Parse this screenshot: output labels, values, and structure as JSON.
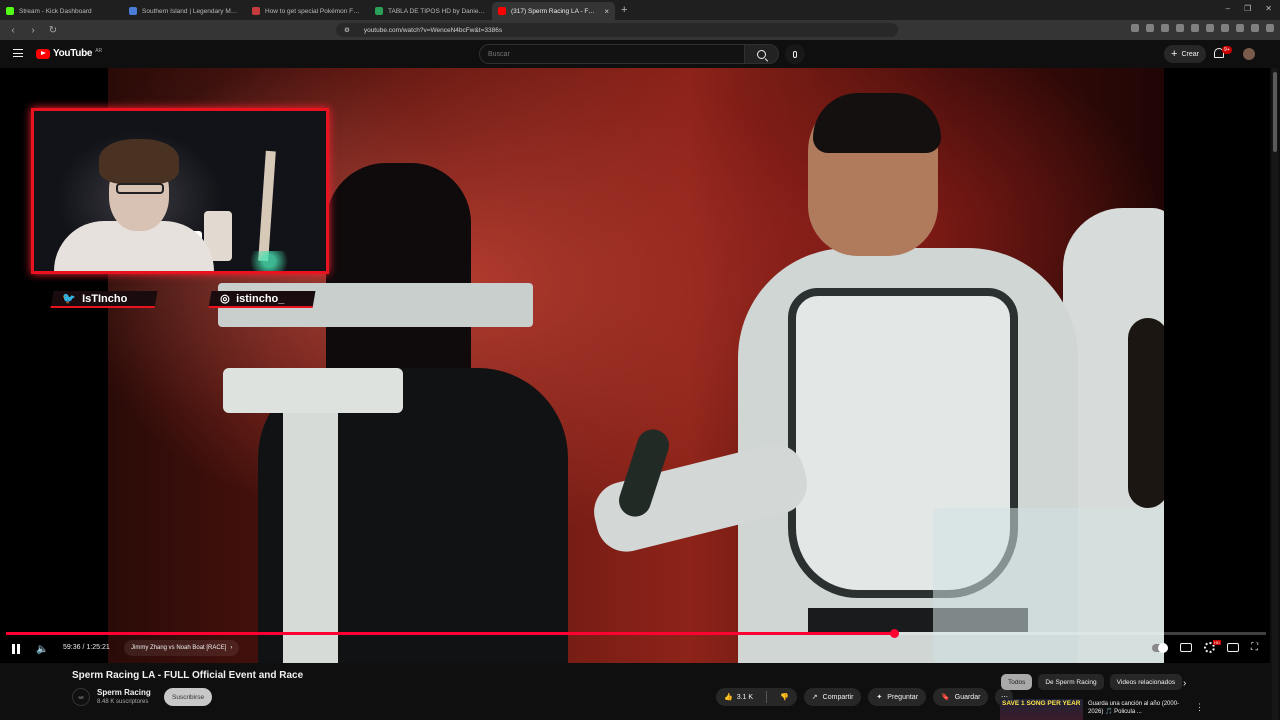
{
  "browser": {
    "tabs": [
      {
        "title": "Stream - Kick Dashboard",
        "color": "#53fc18"
      },
      {
        "title": "Southern Island | Legendary Monum...",
        "color": "#4a7dd8"
      },
      {
        "title": "How to get special Pokémon Forms...",
        "color": "#c33b3b"
      },
      {
        "title": "TABLA DE TIPOS HD by DanielM-G ...",
        "color": "#2b9e57"
      },
      {
        "title": "(317) Sperm Racing LA - FULL ...",
        "color": "#ff0000",
        "active": true
      }
    ],
    "url": "youtube.com/watch?v=WenceN4bcFw&t=3386s",
    "new_tab": "+"
  },
  "masthead": {
    "logo_text": "YouTube",
    "logo_country": "AR",
    "search_placeholder": "Buscar",
    "create_label": "Crear",
    "notifications_badge": "9+"
  },
  "overlay": {
    "twitter_handle": "IsTIncho",
    "instagram_handle": "istincho_"
  },
  "player": {
    "progress_fraction": 0.705,
    "current_time": "59:36",
    "duration": "1:25:21",
    "chapter": "Jimmy Zhang vs Noah Boat [RACE]"
  },
  "video": {
    "title": "Sperm Racing LA - FULL Official Event and Race",
    "channel": "Sperm Racing",
    "subscribers": "8.48 K suscriptores",
    "subscribe_label": "Suscribirse",
    "likes": "3.1 K",
    "share_label": "Compartir",
    "ask_label": "Preguntar",
    "save_label": "Guardar"
  },
  "chips": [
    "Todos",
    "De Sperm Racing",
    "Videos relacionados"
  ],
  "recommendation": {
    "thumb_text": "SAVE 1 SONG PER YEAR",
    "title": "Guarda una canción al año (2000-2026) 🎵 Policula ..."
  }
}
